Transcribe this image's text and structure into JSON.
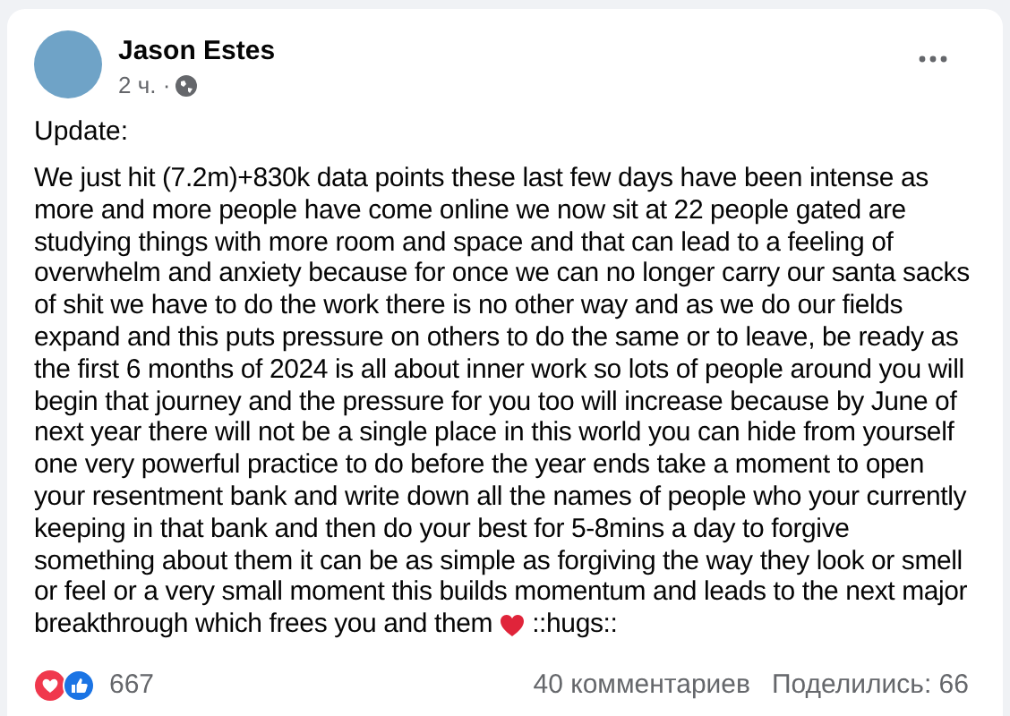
{
  "post": {
    "author": "Jason Estes",
    "time": "2 ч. ·",
    "heading": "Update:",
    "body": "We just hit (7.2m)+830k data points these last few days have been intense as more and more people have come online we now sit at 22 people gated are studying things with more room and space and that can lead to a feeling of overwhelm and anxiety because for once we can no longer carry our santa sacks of shit we have to do the work there is no other way and as we do our fields expand and this puts pressure on others to do the same or to leave, be ready as the first 6 months of 2024 is all about inner work so lots of people around you will begin that journey and the pressure for you too will increase because by June of next year there will not be a single place in this world you can hide from yourself one very powerful practice to do before the year ends take a moment to open your resentment bank and write down all the names of people who your currently keeping in that bank and then do your best for 5-8mins a day to forgive something about them it can be as simple as forgiving the way they look or smell or feel or a very small moment this builds momentum and leads to the next major",
    "last_line": "breakthrough which frees you and them",
    "body_end": "::hugs::",
    "reactions": "667",
    "comments": "40 комментариев",
    "shares": "Поделились: 66"
  }
}
